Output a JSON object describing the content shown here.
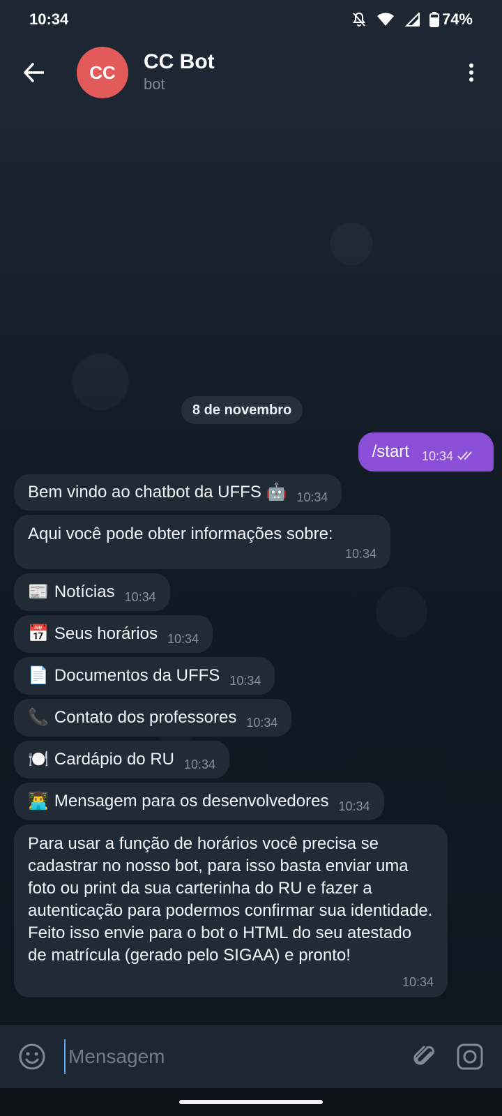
{
  "status_bar": {
    "time": "10:34",
    "battery": "74%",
    "icons": [
      "bell-off-icon",
      "wifi-icon",
      "signal-icon",
      "battery-icon"
    ]
  },
  "header": {
    "avatar_initials": "CC",
    "avatar_color": "#e25a5a",
    "title": "CC Bot",
    "subtitle": "bot"
  },
  "chat": {
    "date_label": "8 de novembro",
    "outgoing": {
      "text": "/start",
      "time": "10:34",
      "color": "#8a4fd6"
    },
    "messages": [
      {
        "emoji": "",
        "text": "Bem vindo ao chatbot da UFFS 🤖",
        "time": "10:34"
      },
      {
        "emoji": "",
        "text": "Aqui você pode obter informações sobre:",
        "time": "10:34"
      },
      {
        "emoji": "📰",
        "text": "Notícias",
        "time": "10:34"
      },
      {
        "emoji": "📅",
        "text": "Seus horários",
        "time": "10:34"
      },
      {
        "emoji": "📄",
        "text": "Documentos da UFFS",
        "time": "10:34"
      },
      {
        "emoji": "📞",
        "text": "Contato dos professores",
        "time": "10:34"
      },
      {
        "emoji": "🍽️",
        "text": "Cardápio do RU",
        "time": "10:34"
      },
      {
        "emoji": "👨‍💻",
        "text": "Mensagem para os desenvolvedores",
        "time": "10:34"
      },
      {
        "emoji": "",
        "text": "Para usar a função de horários você precisa se cadastrar no nosso bot, para isso basta enviar uma foto ou print da sua carterinha do RU e fazer a autenticação para podermos confirmar sua identidade. Feito isso envie para o bot o HTML do seu atestado de matrícula (gerado pelo SIGAA) e pronto!",
        "time": "10:34"
      }
    ]
  },
  "composer": {
    "placeholder": "Mensagem"
  }
}
